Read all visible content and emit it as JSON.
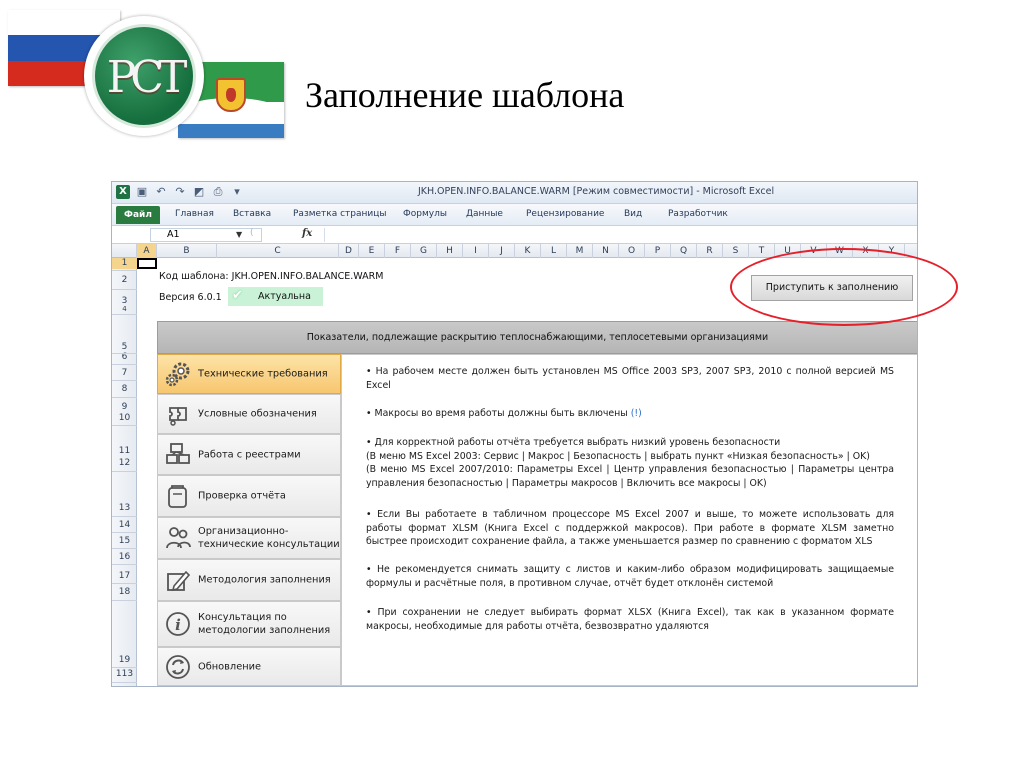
{
  "slide": {
    "title": "Заполнение шаблона",
    "logo_text": "РСТ"
  },
  "colors": {
    "accent_green": "#2a7b3f",
    "active_nav": "#f7c66f",
    "highlight_ellipse": "#e5202a",
    "status_badge": "#c9f2d6"
  },
  "excel": {
    "window_title": "JKH.OPEN.INFO.BALANCE.WARM  [Режим совместимости]  -  Microsoft Excel",
    "ribbon_tabs": [
      "Файл",
      "Главная",
      "Вставка",
      "Разметка страницы",
      "Формулы",
      "Данные",
      "Рецензирование",
      "Вид",
      "Разработчик"
    ],
    "name_box": "A1",
    "fx_label": "fx",
    "columns": [
      "A",
      "B",
      "C",
      "D",
      "E",
      "F",
      "G",
      "H",
      "I",
      "J",
      "K",
      "L",
      "M",
      "N",
      "O",
      "P",
      "Q",
      "R",
      "S",
      "T",
      "U",
      "V",
      "W",
      "X",
      "Y"
    ],
    "rows": [
      "1",
      "2",
      "3",
      "4",
      "5",
      "6",
      "7",
      "8",
      "9",
      "10",
      "11",
      "12",
      "13",
      "14",
      "15",
      "16",
      "17",
      "18",
      "19",
      "113"
    ]
  },
  "template": {
    "code_line": "Код шаблона: JKH.OPEN.INFO.BALANCE.WARM",
    "version_line": "Версия 6.0.1",
    "status": "Актуальна",
    "start_button": "Приступить к заполнению",
    "panel_title": "Показатели, подлежащие раскрытию теплоснабжающими, теплосетевыми организациями"
  },
  "nav": [
    {
      "label": "Технические требования",
      "icon": "gears-icon"
    },
    {
      "label": "Условные обозначения",
      "icon": "legend-icon"
    },
    {
      "label": "Работа с реестрами",
      "icon": "registry-icon"
    },
    {
      "label": "Проверка отчёта",
      "icon": "report-check-icon"
    },
    {
      "label": "Организационно-технические консультации",
      "icon": "people-icon"
    },
    {
      "label": "Методология заполнения",
      "icon": "pencil-icon"
    },
    {
      "label": "Консультация по методологии заполнения",
      "icon": "info-icon"
    },
    {
      "label": "Обновление",
      "icon": "refresh-icon"
    }
  ],
  "requirements": {
    "p1": "• На рабочем месте должен быть установлен MS Office 2003 SP3, 2007 SP3, 2010 с полной версией MS Excel",
    "p2": "• Макросы во время работы должны быть включены",
    "p2_warn": "(!)",
    "p3a": "• Для корректной работы отчёта требуется выбрать низкий уровень безопасности",
    "p3b": "(В меню MS Excel 2003: Сервис | Макрос | Безопасность | выбрать пункт «Низкая безопасность» | OK)",
    "p3c": "(В меню MS Excel 2007/2010: Параметры Excel | Центр управления безопасностью | Параметры центра управления безопасностью | Параметры макросов | Включить все макросы | OK)",
    "p4": "• Если Вы работаете в табличном процессоре MS Excel 2007 и выше, то можете использовать для работы формат XLSM (Книга Excel с поддержкой макросов). При работе в формате XLSM заметно быстрее происходит сохранение файла, а также уменьшается размер по сравнению с форматом XLS",
    "p5": "• Не рекомендуется снимать защиту с листов и каким-либо образом модифицировать защищаемые формулы и расчётные поля, в противном случае, отчёт будет отклонён системой",
    "p6": "• При сохранении не следует выбирать формат XLSX (Книга Excel), так как в указанном формате макросы, необходимые для работы отчёта, безвозвратно удаляются"
  }
}
